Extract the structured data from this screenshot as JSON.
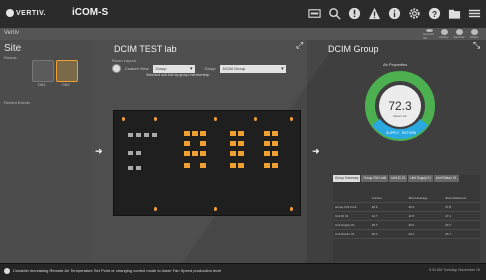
{
  "header": {
    "brand": "VERTIV.",
    "product": "iCOM-S"
  },
  "subbar": {
    "breadcrumb": "Vertiv",
    "icons": [
      "network-icon",
      "history-icon",
      "star-icon",
      "share-icon"
    ],
    "icon_labels": [
      "Network UE",
      "History",
      "Favorite",
      "Share"
    ]
  },
  "site": {
    "title": "Site",
    "rooms_label": "Rooms",
    "room_names": [
      "DB1",
      "DB2"
    ],
    "recent_events_label": "Recent Events"
  },
  "main": {
    "title": "DCIM TEST lab",
    "room_layout_label": "Room Layout",
    "custom_view_label": "Custom View",
    "view_select": "Group",
    "group_label": "Group",
    "group_select": "DCIM Group",
    "hint": "Selected unit info by group membership"
  },
  "group": {
    "title": "DCIM Group",
    "air_properties_label": "Air Properties",
    "gauge_value": "72.3",
    "gauge_sub": "Return Air",
    "supply_label": "SUPPLY",
    "return_label": "RETURN",
    "colors": {
      "green": "#4caf50",
      "blue": "#2aa8e0",
      "orange": "#f0a030"
    }
  },
  "table": {
    "tabs": [
      "Group Summary",
      "Group CW Limit",
      "Unit ID 01",
      "Unit Supply 01",
      "Unit Return 01"
    ],
    "headers": [
      "",
      "Current",
      "Short Average",
      "Short Maximum"
    ],
    "rows": [
      [
        "Group CW Limit",
        "26.6",
        "26.3",
        "27.8"
      ],
      [
        "Unit ID 01",
        "12.7",
        "12.5",
        "17.1"
      ],
      [
        "Unit Supply 01",
        "20.7",
        "20.0",
        "20.7"
      ],
      [
        "Unit Return 01",
        "26.4",
        "26.1",
        "26.7"
      ]
    ]
  },
  "statusbar": {
    "message": "Consider increasing Remote Air Temperature Set Point or changing control mode to lower Fan Speed production level",
    "time": "9:34 AM Tuesday, November 15"
  }
}
